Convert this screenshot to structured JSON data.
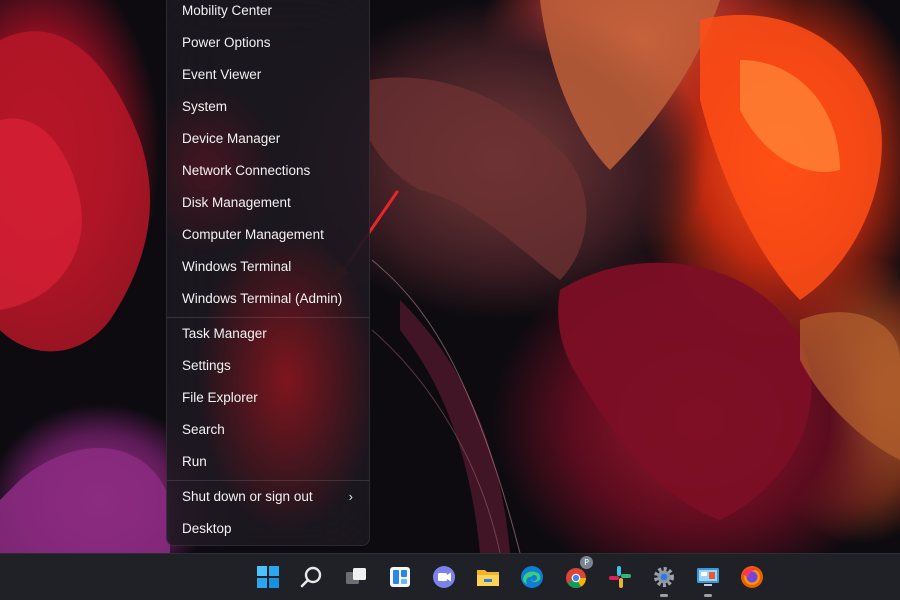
{
  "menu": {
    "items": [
      {
        "label": "Mobility Center"
      },
      {
        "label": "Power Options"
      },
      {
        "label": "Event Viewer"
      },
      {
        "label": "System"
      },
      {
        "label": "Device Manager"
      },
      {
        "label": "Network Connections"
      },
      {
        "label": "Disk Management"
      },
      {
        "label": "Computer Management"
      },
      {
        "label": "Windows Terminal"
      },
      {
        "label": "Windows Terminal (Admin)"
      },
      {
        "label": "Task Manager"
      },
      {
        "label": "Settings"
      },
      {
        "label": "File Explorer"
      },
      {
        "label": "Search"
      },
      {
        "label": "Run"
      },
      {
        "label": "Shut down or sign out",
        "submenu_indicator": "›"
      },
      {
        "label": "Desktop"
      }
    ]
  },
  "taskbar": {
    "icons": [
      {
        "name": "windows-start-icon"
      },
      {
        "name": "search-icon"
      },
      {
        "name": "task-view-icon"
      },
      {
        "name": "widgets-icon"
      },
      {
        "name": "teams-chat-icon"
      },
      {
        "name": "file-explorer-icon"
      },
      {
        "name": "edge-icon"
      },
      {
        "name": "chrome-icon",
        "badge": "P"
      },
      {
        "name": "slack-icon"
      },
      {
        "name": "settings-gear-icon"
      },
      {
        "name": "control-panel-icon"
      },
      {
        "name": "firefox-icon"
      }
    ]
  },
  "colors": {
    "arrow": "#e8262a",
    "menu_text": "#f2f2f2",
    "taskbar_bg": "#1f2127"
  }
}
